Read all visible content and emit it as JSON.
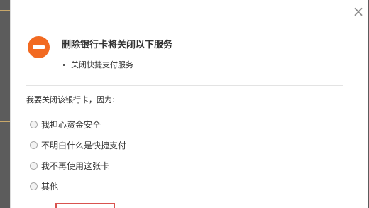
{
  "dialog": {
    "close_glyph": "×",
    "title": "删除银行卡将关闭以下服务",
    "services": [
      "关闭快捷支付服务"
    ],
    "reason_prompt": "我要关闭该银行卡，因为:",
    "reasons": [
      "我担心资金安全",
      "不明白什么是快捷支付",
      "我不再使用这张卡",
      "其他"
    ],
    "icons": {
      "warning": "minus-circle-icon",
      "close": "close-icon"
    },
    "colors": {
      "warning": "#f26a21",
      "button_border": "#d9534f"
    }
  }
}
